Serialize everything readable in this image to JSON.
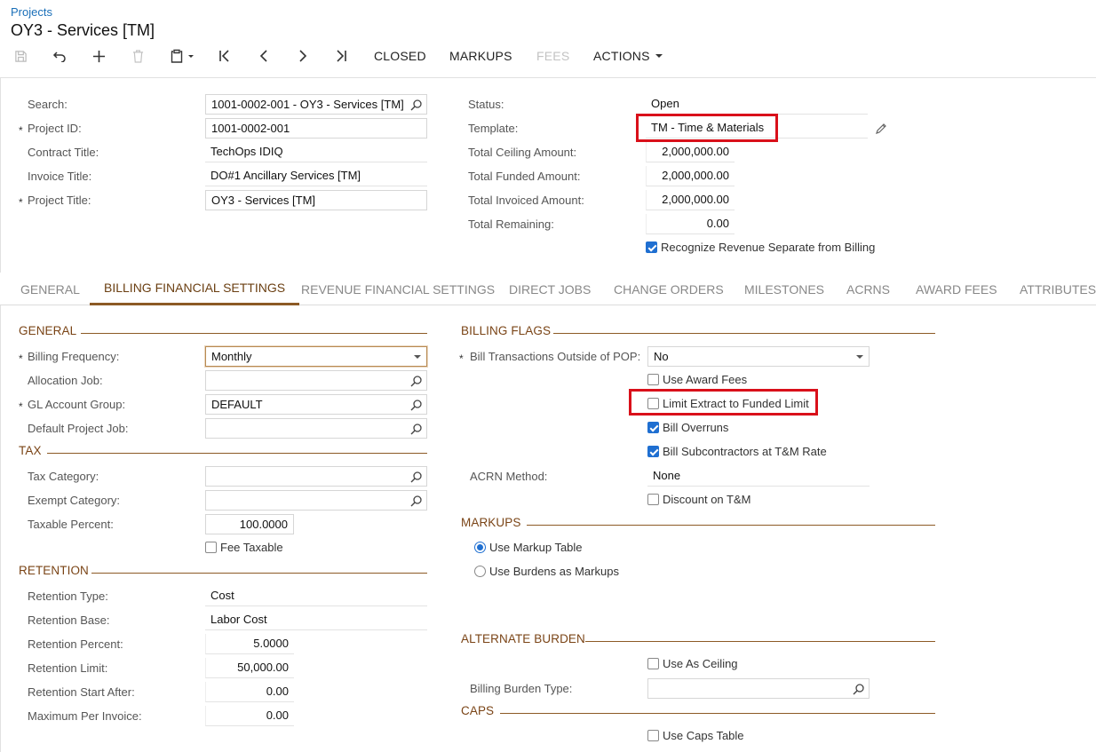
{
  "breadcrumb": "Projects",
  "title": "OY3 - Services [TM]",
  "toolbar": {
    "closed": "CLOSED",
    "markups": "MARKUPS",
    "fees": "FEES",
    "actions": "ACTIONS"
  },
  "header": {
    "search_label": "Search:",
    "search_value": "1001-0002-001 - OY3 - Services [TM]",
    "project_id_label": "Project ID:",
    "project_id_value": "1001-0002-001",
    "contract_title_label": "Contract Title:",
    "contract_title_value": "TechOps IDIQ",
    "invoice_title_label": "Invoice Title:",
    "invoice_title_value": "DO#1 Ancillary Services [TM]",
    "project_title_label": "Project Title:",
    "project_title_value": "OY3 - Services [TM]",
    "status_label": "Status:",
    "status_value": "Open",
    "template_label": "Template:",
    "template_value": "TM - Time & Materials",
    "ceiling_label": "Total Ceiling Amount:",
    "ceiling_value": "2,000,000.00",
    "funded_label": "Total Funded Amount:",
    "funded_value": "2,000,000.00",
    "invoiced_label": "Total Invoiced Amount:",
    "invoiced_value": "2,000,000.00",
    "remaining_label": "Total Remaining:",
    "remaining_value": "0.00",
    "recognize_label": "Recognize Revenue Separate from Billing",
    "recognize_checked": true
  },
  "tabs": [
    {
      "label": "GENERAL",
      "active": false
    },
    {
      "label": "BILLING FINANCIAL SETTINGS",
      "active": true
    },
    {
      "label": "REVENUE FINANCIAL SETTINGS",
      "active": false
    },
    {
      "label": "DIRECT JOBS",
      "active": false
    },
    {
      "label": "CHANGE ORDERS",
      "active": false
    },
    {
      "label": "MILESTONES",
      "active": false
    },
    {
      "label": "ACRNS",
      "active": false
    },
    {
      "label": "AWARD FEES",
      "active": false
    },
    {
      "label": "ATTRIBUTES",
      "active": false
    }
  ],
  "general": {
    "section": "GENERAL",
    "billing_freq_label": "Billing Frequency:",
    "billing_freq_value": "Monthly",
    "allocation_job_label": "Allocation Job:",
    "allocation_job_value": "",
    "gl_group_label": "GL Account Group:",
    "gl_group_value": "DEFAULT",
    "default_job_label": "Default Project Job:",
    "default_job_value": ""
  },
  "tax": {
    "section": "TAX",
    "category_label": "Tax Category:",
    "category_value": "",
    "exempt_label": "Exempt Category:",
    "exempt_value": "",
    "taxable_pct_label": "Taxable Percent:",
    "taxable_pct_value": "100.0000",
    "fee_taxable_label": "Fee Taxable",
    "fee_taxable_checked": false
  },
  "retention": {
    "section": "RETENTION",
    "type_label": "Retention Type:",
    "type_value": "Cost",
    "base_label": "Retention Base:",
    "base_value": "Labor Cost",
    "percent_label": "Retention Percent:",
    "percent_value": "5.0000",
    "limit_label": "Retention Limit:",
    "limit_value": "50,000.00",
    "start_label": "Retention Start After:",
    "start_value": "0.00",
    "max_label": "Maximum Per Invoice:",
    "max_value": "0.00"
  },
  "billing_flags": {
    "section": "BILLING FLAGS",
    "pop_label": "Bill Transactions Outside of POP:",
    "pop_value": "No",
    "use_award_fees": "Use Award Fees",
    "use_award_fees_checked": false,
    "limit_extract": "Limit Extract to Funded Limit",
    "limit_extract_checked": false,
    "bill_overruns": "Bill Overruns",
    "bill_overruns_checked": true,
    "bill_subs": "Bill Subcontractors at T&M Rate",
    "bill_subs_checked": true,
    "acrn_label": "ACRN Method:",
    "acrn_value": "None",
    "discount_tm": "Discount on T&M",
    "discount_tm_checked": false
  },
  "markups": {
    "section": "MARKUPS",
    "use_markup_table": "Use Markup Table",
    "use_burdens": "Use Burdens as Markups",
    "selected": "Use Markup Table"
  },
  "alternate_burden": {
    "section": "ALTERNATE BURDEN",
    "use_as_ceiling": "Use As Ceiling",
    "use_as_ceiling_checked": false,
    "burden_type_label": "Billing Burden Type:",
    "burden_type_value": ""
  },
  "caps": {
    "section": "CAPS",
    "use_caps_table": "Use Caps Table",
    "use_caps_table_checked": false
  },
  "colors": {
    "accent": "#8c5a25",
    "highlight_box": "#d9101a",
    "checkbox_on": "#1f6fd1",
    "link": "#1a6fb8"
  }
}
